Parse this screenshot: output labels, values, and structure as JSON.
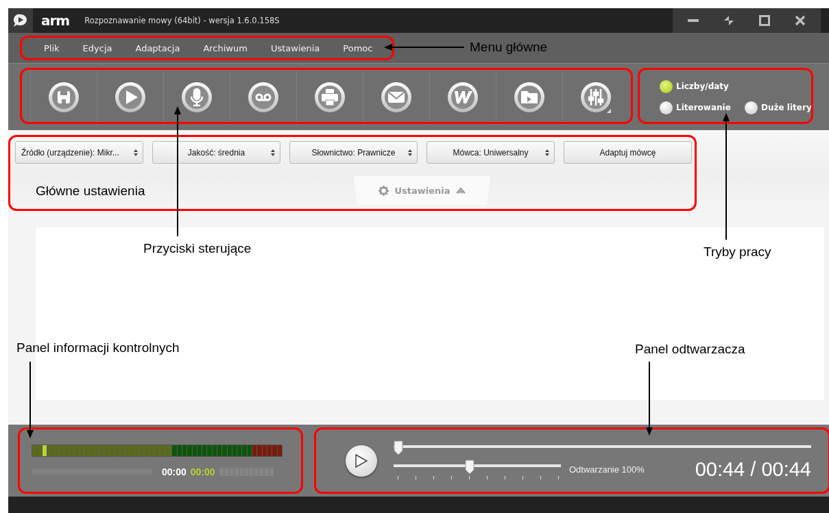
{
  "window": {
    "brand": "arm",
    "title": "Rozpoznawanie mowy (64bit)  - wersja 1.6.0.158S"
  },
  "menu": [
    {
      "label": "Plik"
    },
    {
      "label": "Edycja"
    },
    {
      "label": "Adaptacja"
    },
    {
      "label": "Archiwum"
    },
    {
      "label": "Ustawienia"
    },
    {
      "label": "Pomoc"
    }
  ],
  "toolbar": [
    {
      "kind": "save"
    },
    {
      "kind": "play"
    },
    {
      "kind": "mic"
    },
    {
      "kind": "voicemail"
    },
    {
      "kind": "print"
    },
    {
      "kind": "mail"
    },
    {
      "kind": "word"
    },
    {
      "kind": "folder"
    },
    {
      "kind": "mixer"
    }
  ],
  "modes": [
    {
      "label": "Liczby/daty",
      "on": true
    },
    {
      "label": "Literowanie",
      "on": false
    },
    {
      "label": "Duże litery",
      "on": false
    }
  ],
  "settings": {
    "dropdowns": [
      {
        "value": "Źródło (urządzenie): Mikr..."
      },
      {
        "value": "Jakość: średnia"
      },
      {
        "value": "Słownictwo: Prawnicze"
      },
      {
        "value": "Mówca: Uniwersalny"
      }
    ],
    "button": "Adaptuj mówcę",
    "tab": "Ustawienia"
  },
  "meter": {
    "level": 0.05,
    "elapsed": "00:00",
    "recorded": "00:00"
  },
  "player": {
    "position": {
      "level": 0
    },
    "speed": {
      "level": 0.45
    },
    "speed_label": "Odtwarzanie 100%",
    "time": "00:44 / 00:44"
  },
  "annotations": [
    {
      "text": "Menu główne"
    },
    {
      "text": "Przyciski sterujące"
    },
    {
      "text": "Tryby pracy"
    },
    {
      "text": "Główne ustawienia"
    },
    {
      "text": "Panel informacji kontrolnych"
    },
    {
      "text": "Panel odtwarzacza"
    }
  ]
}
